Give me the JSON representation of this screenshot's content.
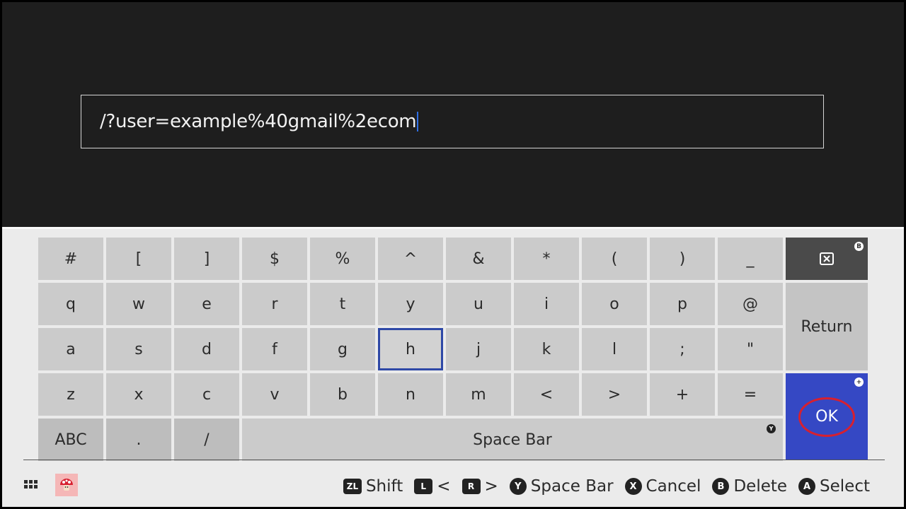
{
  "input": {
    "value": "/?user=example%40gmail%2ecom"
  },
  "keyboard": {
    "rows": [
      [
        "#",
        "[",
        "]",
        "$",
        "%",
        "^",
        "&",
        "*",
        "(",
        ")",
        "_"
      ],
      [
        "q",
        "w",
        "e",
        "r",
        "t",
        "y",
        "u",
        "i",
        "o",
        "p",
        "@"
      ],
      [
        "a",
        "s",
        "d",
        "f",
        "g",
        "h",
        "j",
        "k",
        "l",
        ";",
        "\""
      ],
      [
        "z",
        "x",
        "c",
        "v",
        "b",
        "n",
        "m",
        "<",
        ">",
        "+",
        "="
      ]
    ],
    "bottom_row": {
      "abc": "ABC",
      "period": ".",
      "slash": "/",
      "space": "Space Bar"
    },
    "selected_key": "h",
    "side": {
      "delete_badge": "B",
      "return": "Return",
      "ok": "OK",
      "ok_badge": "+",
      "space_badge": "Y"
    }
  },
  "footer": {
    "hints": [
      {
        "button": "ZL",
        "label": "Shift",
        "shape": "rect"
      },
      {
        "button": "L",
        "label": "<",
        "shape": "rect"
      },
      {
        "button": "R",
        "label": ">",
        "shape": "rect"
      },
      {
        "button": "Y",
        "label": "Space Bar",
        "shape": "round"
      },
      {
        "button": "X",
        "label": "Cancel",
        "shape": "round"
      },
      {
        "button": "B",
        "label": "Delete",
        "shape": "round"
      },
      {
        "button": "A",
        "label": "Select",
        "shape": "round"
      }
    ],
    "menu_icon": "grid-menu-icon",
    "avatar_icon": "mushroom-avatar-icon"
  },
  "colors": {
    "top_bg": "#1e1e1e",
    "keyboard_bg": "#ebebeb",
    "key_bg": "#cbcbcb",
    "ok_bg": "#3548c4",
    "ok_ring": "#d7202f",
    "selection": "#2e48a6",
    "caret": "#2f6fe5"
  }
}
